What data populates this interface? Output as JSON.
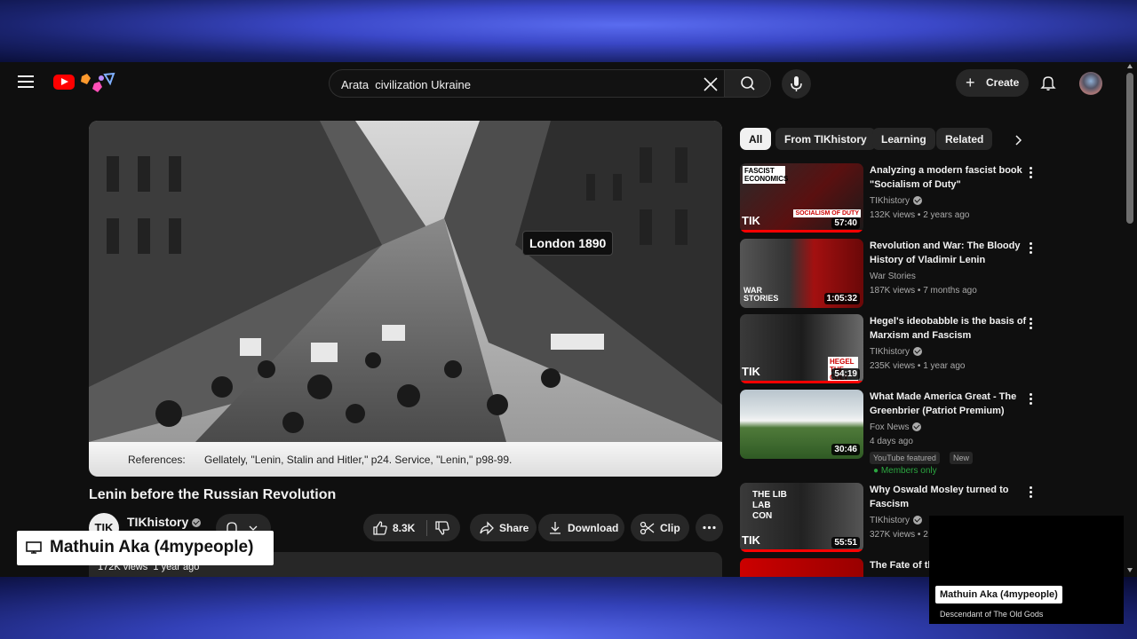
{
  "search": {
    "value": "Arata  civilization Ukraine"
  },
  "header": {
    "create_label": "Create"
  },
  "video": {
    "caption_tag": "London 1890",
    "references_label": "References:",
    "references_text": "Gellately, \"Lenin, Stalin and Hitler,\" p24. Service, \"Lenin,\" p98-99.",
    "title": "Lenin before the Russian Revolution",
    "channel": "TIKhistory",
    "channel_avatar_text": "TIK",
    "likes": "8.3K",
    "share_label": "Share",
    "download_label": "Download",
    "clip_label": "Clip",
    "views": "172K views",
    "age": "1 year ago"
  },
  "chips": [
    "All",
    "From TIKhistory",
    "Learning",
    "Related"
  ],
  "recommendations": [
    {
      "title": "Analyzing a modern fascist book \"Socialism of Duty\"",
      "channel": "TIKhistory",
      "meta": "132K views • 2 years ago",
      "duration": "57:40",
      "thumb_text": "FASCIST ECONOMICS",
      "thumb_text2": "SOCIALISM OF DUTY"
    },
    {
      "title": "Revolution and War: The Bloody History of Vladimir Lenin",
      "channel": "War Stories",
      "meta": "187K views • 7 months ago",
      "duration": "1:05:32",
      "thumb_text": "WAR STORIES"
    },
    {
      "title": "Hegel's ideobabble is the basis of Marxism and Fascism",
      "channel": "TIKhistory",
      "meta": "235K views • 1 year ago",
      "duration": "54:19",
      "thumb_text": "HEGEL THE CULT"
    },
    {
      "title": "What Made America Great - The Greenbrier (Patriot Premium)",
      "channel": "Fox News",
      "meta": "4 days ago",
      "duration": "30:46",
      "badge1": "YouTube featured",
      "badge2": "New",
      "members": "Members only"
    },
    {
      "title": "Why Oswald Mosley turned to Fascism",
      "channel": "TIKhistory",
      "meta": "327K views • 2",
      "duration": "55:51",
      "thumb_text": "THE LIB LAB CON"
    },
    {
      "title": "The Fate of tl"
    }
  ],
  "overlay": {
    "presenter": "Mathuin Aka (4mypeople)",
    "cam_name": "Mathuin Aka (4mypeople)",
    "cam_sub": "Descendant of The Old Gods"
  },
  "colors": {
    "brand_red": "#ff0000",
    "background": "#0f0f0f",
    "chip": "#272727"
  }
}
